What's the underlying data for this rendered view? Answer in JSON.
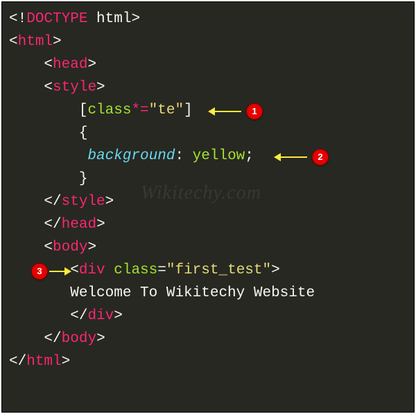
{
  "watermark": "Wikitechy.com",
  "badges": {
    "b1": "1",
    "b2": "2",
    "b3": "3"
  },
  "code": {
    "l1_open": "<!",
    "l1_doctype": "DOCTYPE",
    "l1_html": " html",
    "l1_close": ">",
    "l2_open": "<",
    "l2_tag": "html",
    "l2_close": ">",
    "l3_indent": "    ",
    "l3_open": "<",
    "l3_tag": "head",
    "l3_close": ">",
    "l4_indent": "    ",
    "l4_open": "<",
    "l4_tag": "style",
    "l4_close": ">",
    "l5_indent": "        ",
    "l5_lbr": "[",
    "l5_attr": "class",
    "l5_op": "*=",
    "l5_str": "\"te\"",
    "l5_rbr": "]",
    "l6_indent": "        ",
    "l6_brace": "{",
    "l7_indent": "         ",
    "l7_prop": "background",
    "l7_colon": ": ",
    "l7_val": "yellow",
    "l7_semi": ";",
    "l8_indent": "        ",
    "l8_brace": "}",
    "l9_indent": "    ",
    "l9_open": "</",
    "l9_tag": "style",
    "l9_close": ">",
    "l10_indent": "    ",
    "l10_open": "</",
    "l10_tag": "head",
    "l10_close": ">",
    "l11_indent": "    ",
    "l11_open": "<",
    "l11_tag": "body",
    "l11_close": ">",
    "l12_indent": "       ",
    "l12_open": "<",
    "l12_tag": "div",
    "l12_sp": " ",
    "l12_attr": "class",
    "l12_eq": "=",
    "l12_str": "\"first_test\"",
    "l12_close": ">",
    "l13_indent": "       ",
    "l13_text": "Welcome To Wikitechy Website",
    "l14_indent": "       ",
    "l14_open": "</",
    "l14_tag": "div",
    "l14_close": ">",
    "l15_indent": "    ",
    "l15_open": "</",
    "l15_tag": "body",
    "l15_close": ">",
    "l16_open": "</",
    "l16_tag": "html",
    "l16_close": ">"
  }
}
